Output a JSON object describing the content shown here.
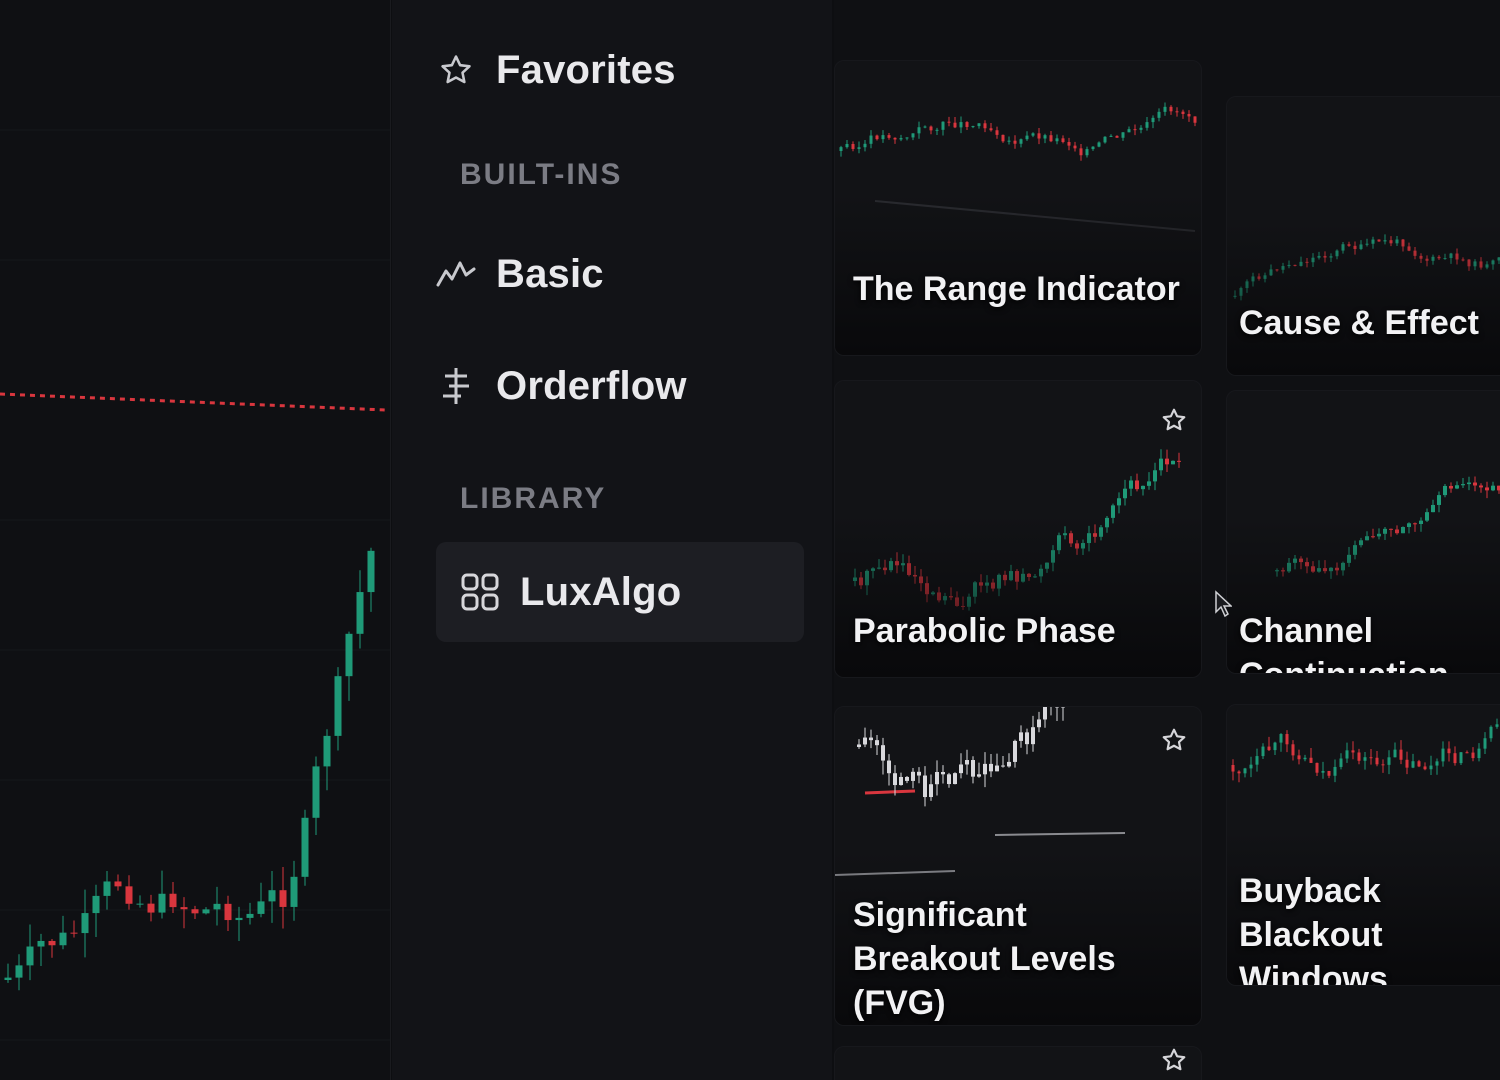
{
  "sidebar": {
    "favorites_label": "Favorites",
    "sections": {
      "builtins": "BUILT-INS",
      "library": "LIBRARY"
    },
    "items": {
      "basic": "Basic",
      "orderflow": "Orderflow",
      "luxalgo": "LuxAlgo"
    },
    "active_item": "LuxAlgo"
  },
  "cards": [
    {
      "title": "The Range Indicator"
    },
    {
      "title": "Cause & Effect"
    },
    {
      "title": "Parabolic Phase"
    },
    {
      "title": "Channel Continuation"
    },
    {
      "title": "Significant Breakout Levels (FVG)"
    },
    {
      "title": "Buyback Blackout Windows"
    }
  ],
  "colors": {
    "background": "#0d0e11",
    "sidebar": "#121317",
    "active_item_bg": "#1d1e23",
    "candle_up": "#1f9a78",
    "candle_down": "#d9363e",
    "section_label": "#7b7c84"
  },
  "icons": {
    "favorites": "star-icon",
    "basic": "trend-line-icon",
    "orderflow": "orderflow-icon",
    "luxalgo": "grid-icon",
    "card_favorite": "star-icon"
  }
}
